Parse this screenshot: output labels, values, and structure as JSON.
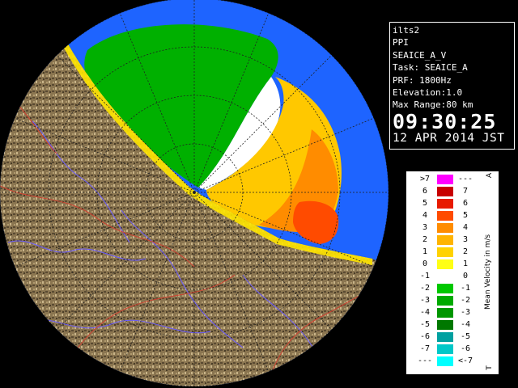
{
  "info": {
    "lines": [
      "ilts2",
      "PPI",
      "SEAICE_A_V",
      "Task: SEAICE_A",
      "PRF: 1800Hz",
      "Elevation:1.0",
      "Max Range:80 km"
    ],
    "time": "09:30:25",
    "date": "12 APR 2014 JST"
  },
  "legend": {
    "title": "Mean Velocity in m/s",
    "top_unit": "A",
    "bottom_unit": "T",
    "rows": [
      {
        "left": ">7",
        "right": "---",
        "color": "#ff00ff"
      },
      {
        "left": "6",
        "right": "7",
        "color": "#c80000"
      },
      {
        "left": "5",
        "right": "6",
        "color": "#e81a00"
      },
      {
        "left": "4",
        "right": "5",
        "color": "#ff4b00"
      },
      {
        "left": "3",
        "right": "4",
        "color": "#ff8c00"
      },
      {
        "left": "2",
        "right": "3",
        "color": "#ffb400"
      },
      {
        "left": "1",
        "right": "2",
        "color": "#ffd200"
      },
      {
        "left": "0",
        "right": "1",
        "color": "#ffff14"
      },
      {
        "left": "-1",
        "right": "0",
        "color": "#ffffff"
      },
      {
        "left": "-2",
        "right": "-1",
        "color": "#00c800"
      },
      {
        "left": "-3",
        "right": "-2",
        "color": "#00aa00"
      },
      {
        "left": "-4",
        "right": "-3",
        "color": "#009600"
      },
      {
        "left": "-5",
        "right": "-4",
        "color": "#007800"
      },
      {
        "left": "-6",
        "right": "-5",
        "color": "#00a0a0"
      },
      {
        "left": "-7",
        "right": "-6",
        "color": "#00c8c8"
      },
      {
        "left": "---",
        "right": "<-7",
        "color": "#00ffff"
      }
    ]
  },
  "colors": {
    "sea": "#1e64ff",
    "outside": "#000000",
    "land": "#8a7550"
  }
}
